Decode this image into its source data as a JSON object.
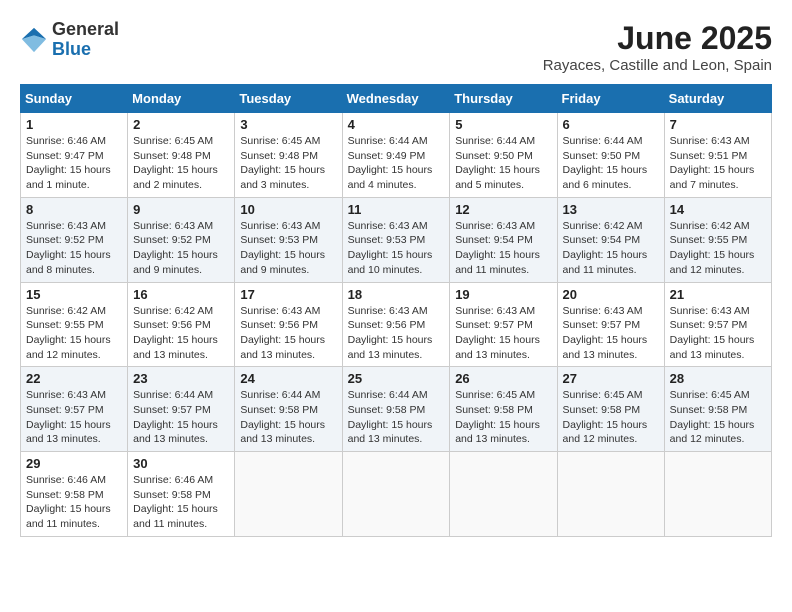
{
  "header": {
    "logo_general": "General",
    "logo_blue": "Blue",
    "month_title": "June 2025",
    "location": "Rayaces, Castille and Leon, Spain"
  },
  "days_of_week": [
    "Sunday",
    "Monday",
    "Tuesday",
    "Wednesday",
    "Thursday",
    "Friday",
    "Saturday"
  ],
  "weeks": [
    [
      {
        "day": "1",
        "sunrise": "Sunrise: 6:46 AM",
        "sunset": "Sunset: 9:47 PM",
        "daylight": "Daylight: 15 hours and 1 minute."
      },
      {
        "day": "2",
        "sunrise": "Sunrise: 6:45 AM",
        "sunset": "Sunset: 9:48 PM",
        "daylight": "Daylight: 15 hours and 2 minutes."
      },
      {
        "day": "3",
        "sunrise": "Sunrise: 6:45 AM",
        "sunset": "Sunset: 9:48 PM",
        "daylight": "Daylight: 15 hours and 3 minutes."
      },
      {
        "day": "4",
        "sunrise": "Sunrise: 6:44 AM",
        "sunset": "Sunset: 9:49 PM",
        "daylight": "Daylight: 15 hours and 4 minutes."
      },
      {
        "day": "5",
        "sunrise": "Sunrise: 6:44 AM",
        "sunset": "Sunset: 9:50 PM",
        "daylight": "Daylight: 15 hours and 5 minutes."
      },
      {
        "day": "6",
        "sunrise": "Sunrise: 6:44 AM",
        "sunset": "Sunset: 9:50 PM",
        "daylight": "Daylight: 15 hours and 6 minutes."
      },
      {
        "day": "7",
        "sunrise": "Sunrise: 6:43 AM",
        "sunset": "Sunset: 9:51 PM",
        "daylight": "Daylight: 15 hours and 7 minutes."
      }
    ],
    [
      {
        "day": "8",
        "sunrise": "Sunrise: 6:43 AM",
        "sunset": "Sunset: 9:52 PM",
        "daylight": "Daylight: 15 hours and 8 minutes."
      },
      {
        "day": "9",
        "sunrise": "Sunrise: 6:43 AM",
        "sunset": "Sunset: 9:52 PM",
        "daylight": "Daylight: 15 hours and 9 minutes."
      },
      {
        "day": "10",
        "sunrise": "Sunrise: 6:43 AM",
        "sunset": "Sunset: 9:53 PM",
        "daylight": "Daylight: 15 hours and 9 minutes."
      },
      {
        "day": "11",
        "sunrise": "Sunrise: 6:43 AM",
        "sunset": "Sunset: 9:53 PM",
        "daylight": "Daylight: 15 hours and 10 minutes."
      },
      {
        "day": "12",
        "sunrise": "Sunrise: 6:43 AM",
        "sunset": "Sunset: 9:54 PM",
        "daylight": "Daylight: 15 hours and 11 minutes."
      },
      {
        "day": "13",
        "sunrise": "Sunrise: 6:42 AM",
        "sunset": "Sunset: 9:54 PM",
        "daylight": "Daylight: 15 hours and 11 minutes."
      },
      {
        "day": "14",
        "sunrise": "Sunrise: 6:42 AM",
        "sunset": "Sunset: 9:55 PM",
        "daylight": "Daylight: 15 hours and 12 minutes."
      }
    ],
    [
      {
        "day": "15",
        "sunrise": "Sunrise: 6:42 AM",
        "sunset": "Sunset: 9:55 PM",
        "daylight": "Daylight: 15 hours and 12 minutes."
      },
      {
        "day": "16",
        "sunrise": "Sunrise: 6:42 AM",
        "sunset": "Sunset: 9:56 PM",
        "daylight": "Daylight: 15 hours and 13 minutes."
      },
      {
        "day": "17",
        "sunrise": "Sunrise: 6:43 AM",
        "sunset": "Sunset: 9:56 PM",
        "daylight": "Daylight: 15 hours and 13 minutes."
      },
      {
        "day": "18",
        "sunrise": "Sunrise: 6:43 AM",
        "sunset": "Sunset: 9:56 PM",
        "daylight": "Daylight: 15 hours and 13 minutes."
      },
      {
        "day": "19",
        "sunrise": "Sunrise: 6:43 AM",
        "sunset": "Sunset: 9:57 PM",
        "daylight": "Daylight: 15 hours and 13 minutes."
      },
      {
        "day": "20",
        "sunrise": "Sunrise: 6:43 AM",
        "sunset": "Sunset: 9:57 PM",
        "daylight": "Daylight: 15 hours and 13 minutes."
      },
      {
        "day": "21",
        "sunrise": "Sunrise: 6:43 AM",
        "sunset": "Sunset: 9:57 PM",
        "daylight": "Daylight: 15 hours and 13 minutes."
      }
    ],
    [
      {
        "day": "22",
        "sunrise": "Sunrise: 6:43 AM",
        "sunset": "Sunset: 9:57 PM",
        "daylight": "Daylight: 15 hours and 13 minutes."
      },
      {
        "day": "23",
        "sunrise": "Sunrise: 6:44 AM",
        "sunset": "Sunset: 9:57 PM",
        "daylight": "Daylight: 15 hours and 13 minutes."
      },
      {
        "day": "24",
        "sunrise": "Sunrise: 6:44 AM",
        "sunset": "Sunset: 9:58 PM",
        "daylight": "Daylight: 15 hours and 13 minutes."
      },
      {
        "day": "25",
        "sunrise": "Sunrise: 6:44 AM",
        "sunset": "Sunset: 9:58 PM",
        "daylight": "Daylight: 15 hours and 13 minutes."
      },
      {
        "day": "26",
        "sunrise": "Sunrise: 6:45 AM",
        "sunset": "Sunset: 9:58 PM",
        "daylight": "Daylight: 15 hours and 13 minutes."
      },
      {
        "day": "27",
        "sunrise": "Sunrise: 6:45 AM",
        "sunset": "Sunset: 9:58 PM",
        "daylight": "Daylight: 15 hours and 12 minutes."
      },
      {
        "day": "28",
        "sunrise": "Sunrise: 6:45 AM",
        "sunset": "Sunset: 9:58 PM",
        "daylight": "Daylight: 15 hours and 12 minutes."
      }
    ],
    [
      {
        "day": "29",
        "sunrise": "Sunrise: 6:46 AM",
        "sunset": "Sunset: 9:58 PM",
        "daylight": "Daylight: 15 hours and 11 minutes."
      },
      {
        "day": "30",
        "sunrise": "Sunrise: 6:46 AM",
        "sunset": "Sunset: 9:58 PM",
        "daylight": "Daylight: 15 hours and 11 minutes."
      },
      null,
      null,
      null,
      null,
      null
    ]
  ]
}
